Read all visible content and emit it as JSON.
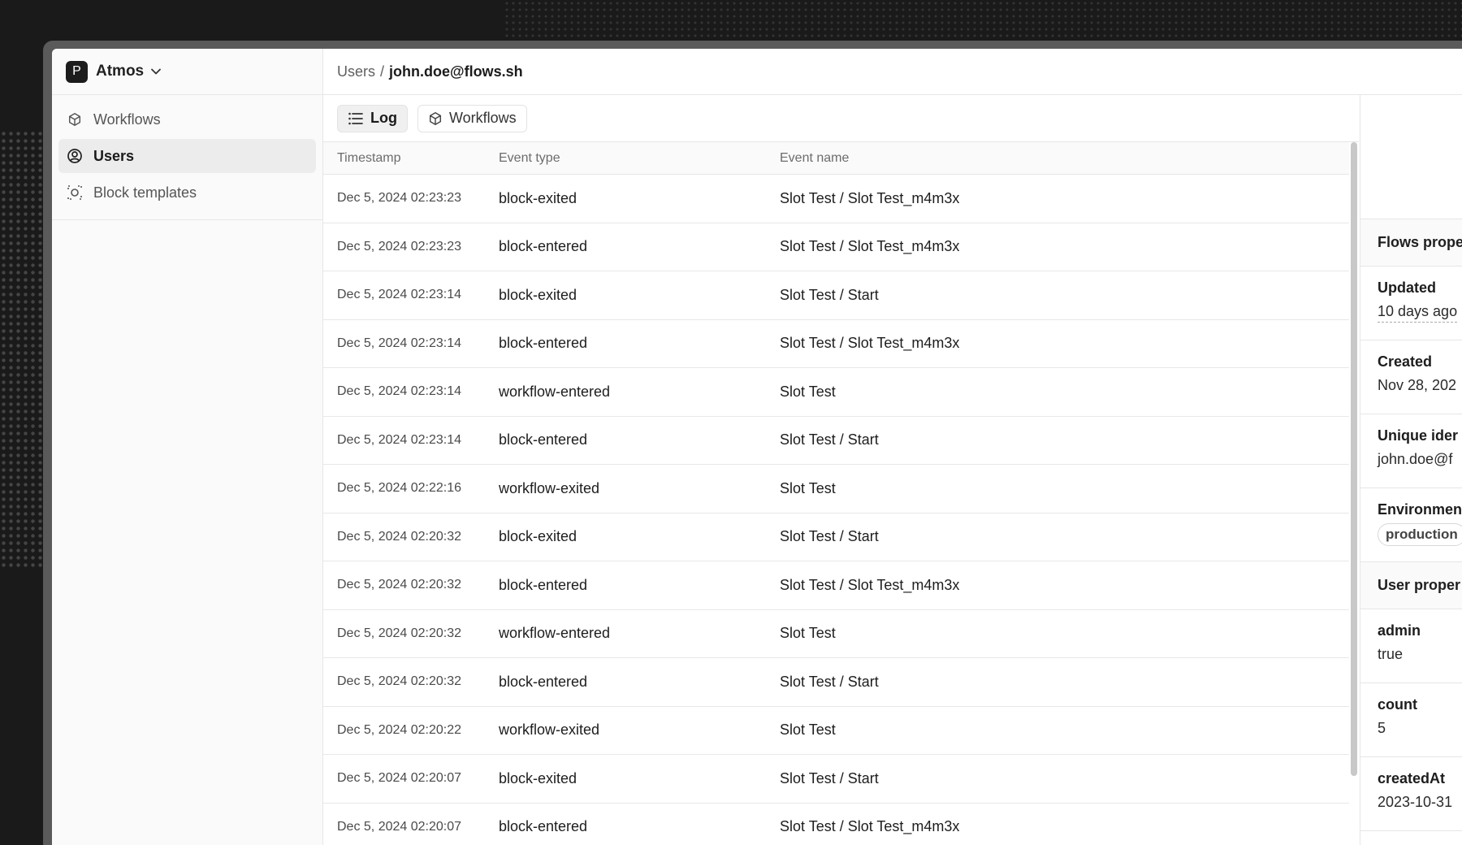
{
  "org": {
    "badge": "P",
    "name": "Atmos"
  },
  "sidebar": {
    "items": [
      {
        "label": "Workflows",
        "icon": "cube-icon",
        "active": false
      },
      {
        "label": "Users",
        "icon": "user-circle-icon",
        "active": true
      },
      {
        "label": "Block templates",
        "icon": "block-template-icon",
        "active": false
      }
    ]
  },
  "breadcrumb": {
    "root": "Users",
    "separator": "/",
    "current": "john.doe@flows.sh"
  },
  "tabs": [
    {
      "label": "Log",
      "icon": "list-icon",
      "active": true
    },
    {
      "label": "Workflows",
      "icon": "cube-icon",
      "active": false
    }
  ],
  "table": {
    "columns": [
      "Timestamp",
      "Event type",
      "Event name"
    ],
    "rows": [
      [
        "Dec 5, 2024 02:23:23",
        "block-exited",
        "Slot Test / Slot Test_m4m3x"
      ],
      [
        "Dec 5, 2024 02:23:23",
        "block-entered",
        "Slot Test / Slot Test_m4m3x"
      ],
      [
        "Dec 5, 2024 02:23:14",
        "block-exited",
        "Slot Test / Start"
      ],
      [
        "Dec 5, 2024 02:23:14",
        "block-entered",
        "Slot Test / Slot Test_m4m3x"
      ],
      [
        "Dec 5, 2024 02:23:14",
        "workflow-entered",
        "Slot Test"
      ],
      [
        "Dec 5, 2024 02:23:14",
        "block-entered",
        "Slot Test / Start"
      ],
      [
        "Dec 5, 2024 02:22:16",
        "workflow-exited",
        "Slot Test"
      ],
      [
        "Dec 5, 2024 02:20:32",
        "block-exited",
        "Slot Test / Start"
      ],
      [
        "Dec 5, 2024 02:20:32",
        "block-entered",
        "Slot Test / Slot Test_m4m3x"
      ],
      [
        "Dec 5, 2024 02:20:32",
        "workflow-entered",
        "Slot Test"
      ],
      [
        "Dec 5, 2024 02:20:32",
        "block-entered",
        "Slot Test / Start"
      ],
      [
        "Dec 5, 2024 02:20:22",
        "workflow-exited",
        "Slot Test"
      ],
      [
        "Dec 5, 2024 02:20:07",
        "block-exited",
        "Slot Test / Start"
      ],
      [
        "Dec 5, 2024 02:20:07",
        "block-entered",
        "Slot Test / Slot Test_m4m3x"
      ]
    ]
  },
  "panel": {
    "flows_title": "Flows prope",
    "flows_props": [
      {
        "label": "Updated",
        "value": "10 days ago"
      },
      {
        "label": "Created",
        "value": "Nov 28, 202"
      },
      {
        "label": "Unique ider",
        "value": "john.doe@f"
      }
    ],
    "environment": {
      "label": "Environmen",
      "value": "production"
    },
    "user_title": "User proper",
    "user_props": [
      {
        "label": "admin",
        "value": "true"
      },
      {
        "label": "count",
        "value": "5"
      },
      {
        "label": "createdAt",
        "value": "2023-10-31"
      }
    ]
  }
}
